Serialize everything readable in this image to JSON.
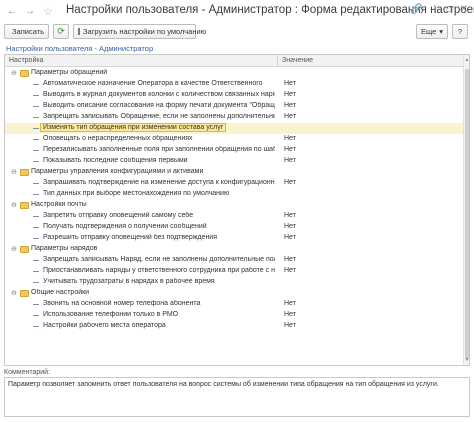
{
  "window": {
    "title": "Настройки пользователя - Администратор : Форма редактирования настроек"
  },
  "toolbar": {
    "save_label": "Записать",
    "defaults_label": "Загрузить настройки по умолчанию",
    "more_label": "Еще",
    "more_chevron": "▾",
    "help_label": "?"
  },
  "breadcrumb": "Настройки пользователя - Администратор",
  "table": {
    "headers": {
      "setting": "Настройка",
      "value": "Значение"
    },
    "rows": [
      {
        "type": "group",
        "name": "Параметры обращений",
        "value": ""
      },
      {
        "type": "item",
        "name": "Автоматическое назначение Оператора в качестве Ответственного",
        "value": "Нет"
      },
      {
        "type": "item",
        "name": "Выводить в журнал документов колонки с количеством связанных нарядов",
        "value": "Нет"
      },
      {
        "type": "item",
        "name": "Выводить описание согласования на форму печати документа \"Обращение\"",
        "value": "Нет"
      },
      {
        "type": "item",
        "name": "Запрещать записывать Обращение, если не заполнены дополнительные поля",
        "value": "Нет"
      },
      {
        "type": "item",
        "name": "Изменять тип обращения при изменении состава услуг",
        "value": "",
        "selected": true
      },
      {
        "type": "item",
        "name": "Оповещать о нераспределенных обращениях",
        "value": "Нет"
      },
      {
        "type": "item",
        "name": "Перезаписывать заполненные поля при заполнении обращения по шаблону",
        "value": "Нет"
      },
      {
        "type": "item",
        "name": "Показывать последние сообщения первыми",
        "value": "Нет"
      },
      {
        "type": "group",
        "name": "Параметры управления конфигурациями и активами",
        "value": ""
      },
      {
        "type": "item",
        "name": "Запрашивать подтверждение на изменение доступа к конфигурационной единице",
        "value": "Нет"
      },
      {
        "type": "item",
        "name": "Тип данных при выборе местонахождения по умолчанию",
        "value": ""
      },
      {
        "type": "group",
        "name": "Настройки почты",
        "value": ""
      },
      {
        "type": "item",
        "name": "Запретить отправку оповещений самому себе",
        "value": "Нет"
      },
      {
        "type": "item",
        "name": "Получать подтверждения о получении сообщений",
        "value": "Нет"
      },
      {
        "type": "item",
        "name": "Разрешить отправку оповещений без подтверждения",
        "value": "Нет"
      },
      {
        "type": "group",
        "name": "Параметры нарядов",
        "value": ""
      },
      {
        "type": "item",
        "name": "Запрещать записывать Наряд, если не заполнены дополнительные поля",
        "value": "Нет"
      },
      {
        "type": "item",
        "name": "Приостанавливать наряды у ответственного сотрудника при работе с нескольки...",
        "value": "Нет"
      },
      {
        "type": "item",
        "name": "Учитывать трудозатраты в нарядах в рабочее время",
        "value": ""
      },
      {
        "type": "group",
        "name": "Общие настройки",
        "value": ""
      },
      {
        "type": "item",
        "name": "Звонить на основной номер телефона абонента",
        "value": "Нет"
      },
      {
        "type": "item",
        "name": "Использование телефонии только в РМО",
        "value": "Нет"
      },
      {
        "type": "item",
        "name": "Настройки рабочего места оператора",
        "value": "Нет"
      }
    ]
  },
  "comment": {
    "label": "Комментарий:",
    "text": "Параметр позволяет запомнить ответ пользователя на вопрос системы об изменении типа обращения на тип обращения из услуги."
  }
}
